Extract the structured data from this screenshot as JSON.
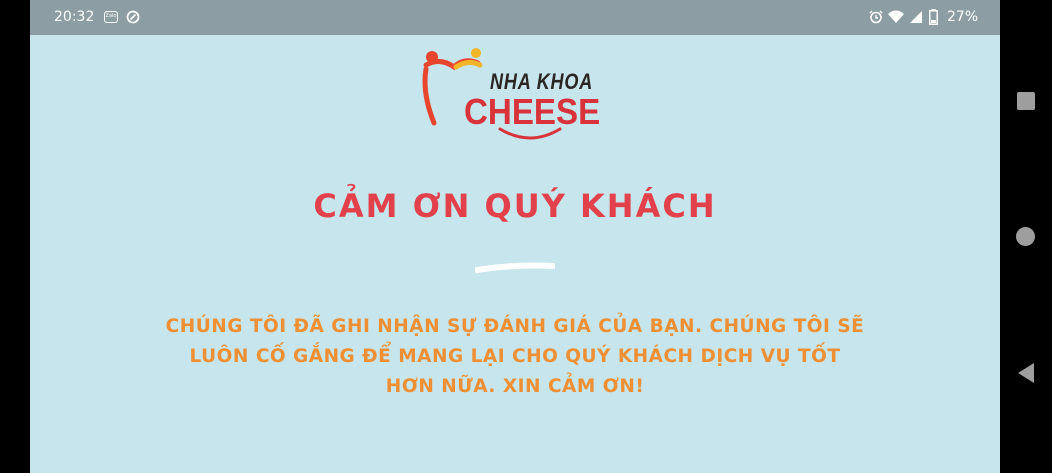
{
  "status_bar": {
    "time": "20:32",
    "battery_percent": "27%",
    "icons": [
      "zalo-icon",
      "sync-icon",
      "alarm-icon",
      "wifi-icon",
      "signal-icon",
      "battery-icon"
    ]
  },
  "logo": {
    "top_text": "NHA KHOA",
    "main_text": "CHEESE"
  },
  "title": "CẢM ƠN QUÝ KHÁCH",
  "message": "CHÚNG TÔI ĐÃ GHI NHẬN SỰ ĐÁNH GIÁ CỦA BẠN. CHÚNG TÔI SẼ LUÔN CỐ GẮNG ĐỂ MANG LẠI CHO QUÝ KHÁCH DỊCH VỤ TỐT HƠN NỮA. XIN CẢM ƠN!",
  "colors": {
    "background": "#c6e5ec",
    "title": "#e2404a",
    "message": "#ef8f33",
    "status_bar": "#8c9ea3"
  },
  "nav_bar": {
    "buttons": [
      "recents-button",
      "home-button",
      "back-button"
    ]
  }
}
